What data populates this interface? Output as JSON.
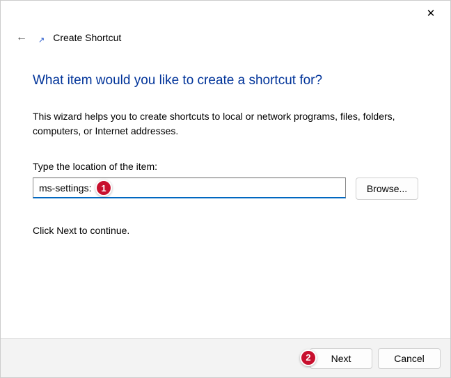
{
  "titlebar": {
    "close": "✕"
  },
  "header": {
    "back": "←",
    "shortcut_glyph": "↗",
    "title": "Create Shortcut"
  },
  "main": {
    "heading": "What item would you like to create a shortcut for?",
    "description": "This wizard helps you to create shortcuts to local or network programs, files, folders, computers, or Internet addresses.",
    "location_label": "Type the location of the item:",
    "location_value": "ms-settings:",
    "browse_label": "Browse...",
    "continue_text": "Click Next to continue."
  },
  "footer": {
    "next_label": "Next",
    "cancel_label": "Cancel"
  },
  "annotations": {
    "one": "1",
    "two": "2"
  }
}
